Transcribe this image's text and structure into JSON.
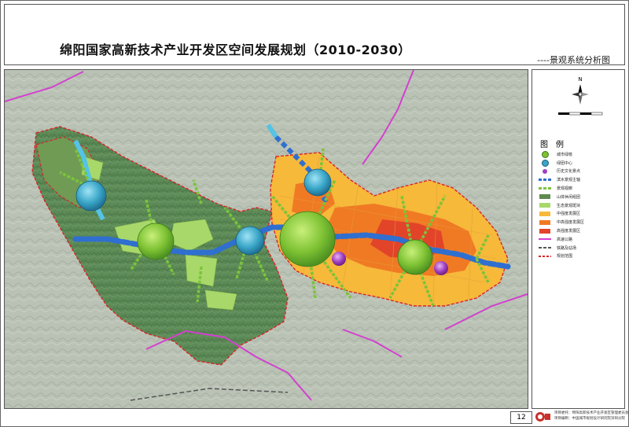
{
  "header": {
    "title": "绵阳国家高新技术产业开发区空间发展规划（2010-2030）",
    "subtitle": "----景观系统分析图"
  },
  "legend": {
    "title": "图　例",
    "items": [
      {
        "label": "城市绿核",
        "symbol": "circle",
        "color": "#7ec234"
      },
      {
        "label": "绿团中心",
        "symbol": "circle",
        "color": "#3aa6c8"
      },
      {
        "label": "历史文化景点",
        "symbol": "circle",
        "color": "#a040c0"
      },
      {
        "label": "滨水景观主轴",
        "symbol": "arrow",
        "color": "#2f6fd0"
      },
      {
        "label": "景观视廊",
        "symbol": "arrow",
        "color": "#7bc43a"
      },
      {
        "label": "山体休闲组团",
        "symbol": "rect",
        "color": "#5f8a4e"
      },
      {
        "label": "生态景观斑块",
        "symbol": "rect",
        "color": "#a8d86a"
      },
      {
        "label": "中强度发展区",
        "symbol": "rect",
        "color": "#f6b93a"
      },
      {
        "label": "中高强度发展区",
        "symbol": "rect",
        "color": "#f07a24"
      },
      {
        "label": "高强度发展区",
        "symbol": "rect",
        "color": "#e2442a"
      },
      {
        "label": "高速公路",
        "symbol": "line",
        "color": "#d43fd0"
      },
      {
        "label": "铁路及站场",
        "symbol": "line",
        "color": "#555555"
      },
      {
        "label": "规划范围",
        "symbol": "dashed",
        "color": "#d8252a"
      }
    ]
  },
  "footer": {
    "page_number": "12",
    "credits_line1": "项目委托：绵阳高新技术产业开发区管理委员会",
    "credits_line2": "项目编制：中国城市规划设计研究院深圳分院"
  }
}
